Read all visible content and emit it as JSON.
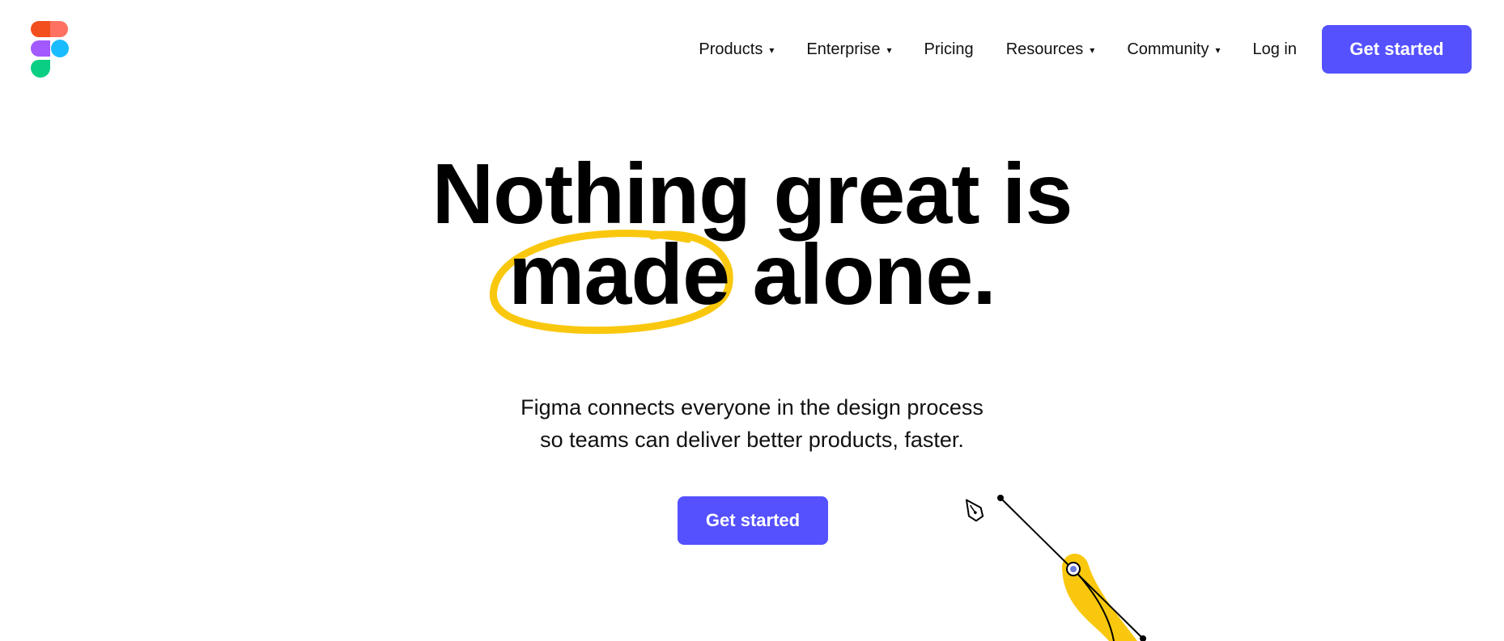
{
  "brand": {
    "name": "Figma",
    "logo_colors": [
      "#f24e1e",
      "#ff7262",
      "#a259ff",
      "#1abcfe",
      "#0acf83"
    ]
  },
  "nav": {
    "items": [
      {
        "label": "Products",
        "has_dropdown": true
      },
      {
        "label": "Enterprise",
        "has_dropdown": true
      },
      {
        "label": "Pricing",
        "has_dropdown": false
      },
      {
        "label": "Resources",
        "has_dropdown": true
      },
      {
        "label": "Community",
        "has_dropdown": true
      }
    ],
    "login_label": "Log in",
    "cta_label": "Get started",
    "caret": "▾"
  },
  "hero": {
    "headline_line1": "Nothing great is",
    "headline_circled_word": "made",
    "headline_line2_rest": " alone.",
    "subhead_line1": "Figma connects everyone in the design process",
    "subhead_line2": "so teams can deliver better products, faster.",
    "cta_label": "Get started"
  },
  "colors": {
    "accent": "#5551ff",
    "highlight": "#f9c80e"
  },
  "icons": {
    "pen_tool": "pen-tool-icon"
  }
}
